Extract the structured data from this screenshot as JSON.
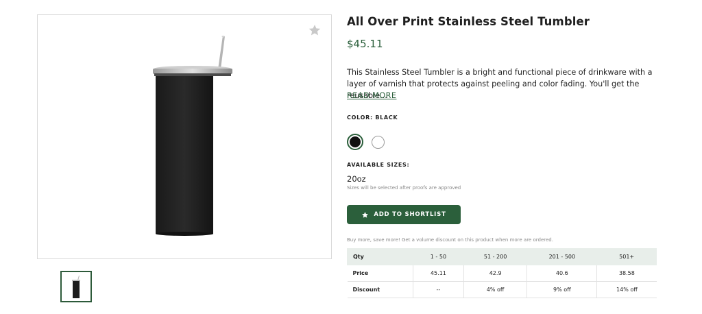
{
  "product": {
    "title": "All Over Print Stainless Steel Tumbler",
    "price": "$45.11",
    "description": "This Stainless Steel Tumbler is a bright and functional piece of drinkware with a layer of varnish that protects against peeling and color fading. You'll get the reusable...",
    "read_more_label": "READ MORE",
    "color_label": "COLOR: BLACK",
    "colors": [
      {
        "name": "Black",
        "hex": "#111111",
        "selected": true
      },
      {
        "name": "White",
        "hex": "#ffffff",
        "selected": false
      }
    ],
    "sizes_label": "AVAILABLE SIZES:",
    "size_value": "20oz",
    "size_note": "Sizes will be selected after proofs are approved",
    "shortlist_label": "ADD TO SHORTLIST",
    "bulk_note": "Buy more, save more! Get a volume discount on this product when more are ordered."
  },
  "gallery": {
    "favorite_icon": "star-icon",
    "thumbnails": [
      {
        "alt": "Black tumbler thumbnail",
        "selected": true
      }
    ]
  },
  "pricing_table": {
    "header": [
      "Qty",
      "1 - 50",
      "51 - 200",
      "201 - 500",
      "501+"
    ],
    "rows": [
      [
        "Price",
        "45.11",
        "42.9",
        "40.6",
        "38.58"
      ],
      [
        "Discount",
        "--",
        "4% off",
        "9% off",
        "14% off"
      ]
    ]
  },
  "colors": {
    "accent": "#2b5f3b",
    "table_header_bg": "#e8eeea"
  }
}
